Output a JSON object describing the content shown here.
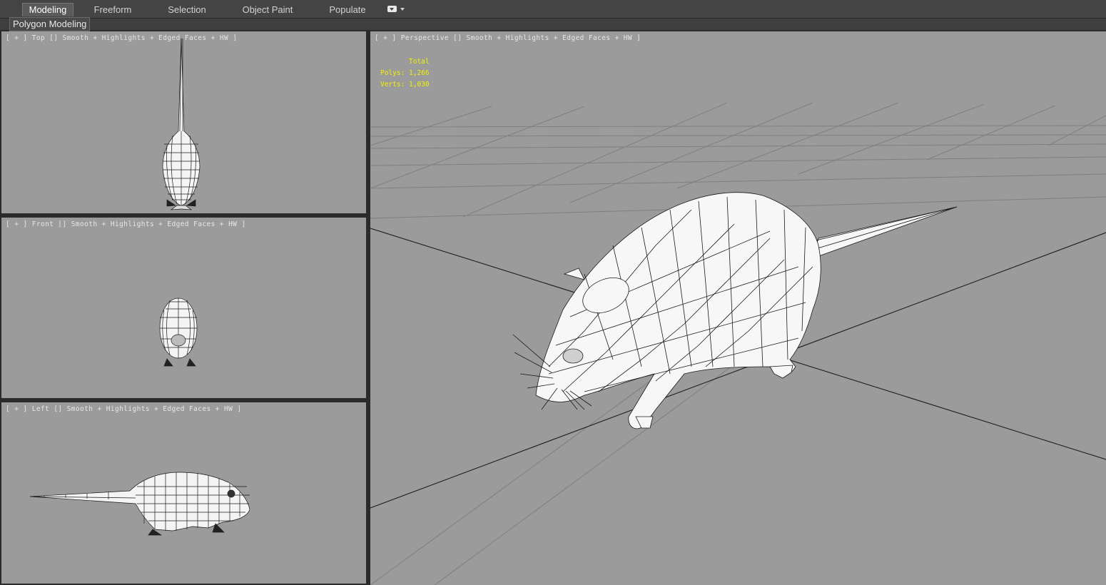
{
  "ribbon": {
    "tabs": [
      {
        "label": "Modeling",
        "active": true
      },
      {
        "label": "Freeform",
        "active": false
      },
      {
        "label": "Selection",
        "active": false
      },
      {
        "label": "Object Paint",
        "active": false
      },
      {
        "label": "Populate",
        "active": false
      }
    ],
    "options_icon": "ribbon-options-dropdown-icon",
    "panel_label": "Polygon Modeling"
  },
  "viewports": {
    "top": {
      "label": "[ + ] Top [] Smooth + Highlights + Edged Faces + HW ]"
    },
    "front": {
      "label": "[ + ] Front [] Smooth + Highlights + Edged Faces + HW ]"
    },
    "left": {
      "label": "[ + ] Left [] Smooth + Highlights + Edged Faces + HW ]"
    },
    "perspective": {
      "label": "[ + ] Perspective [] Smooth + Highlights + Edged Faces + HW ]",
      "stats": {
        "total_label": "Total",
        "polys": "Polys: 1,266",
        "verts": "Verts: 1,030"
      }
    }
  },
  "colors": {
    "viewport_bg": "#9b9b9b",
    "stats_text": "#f2f200",
    "wire": "#1a1a1a",
    "mesh_fill": "#f7f7f7"
  }
}
